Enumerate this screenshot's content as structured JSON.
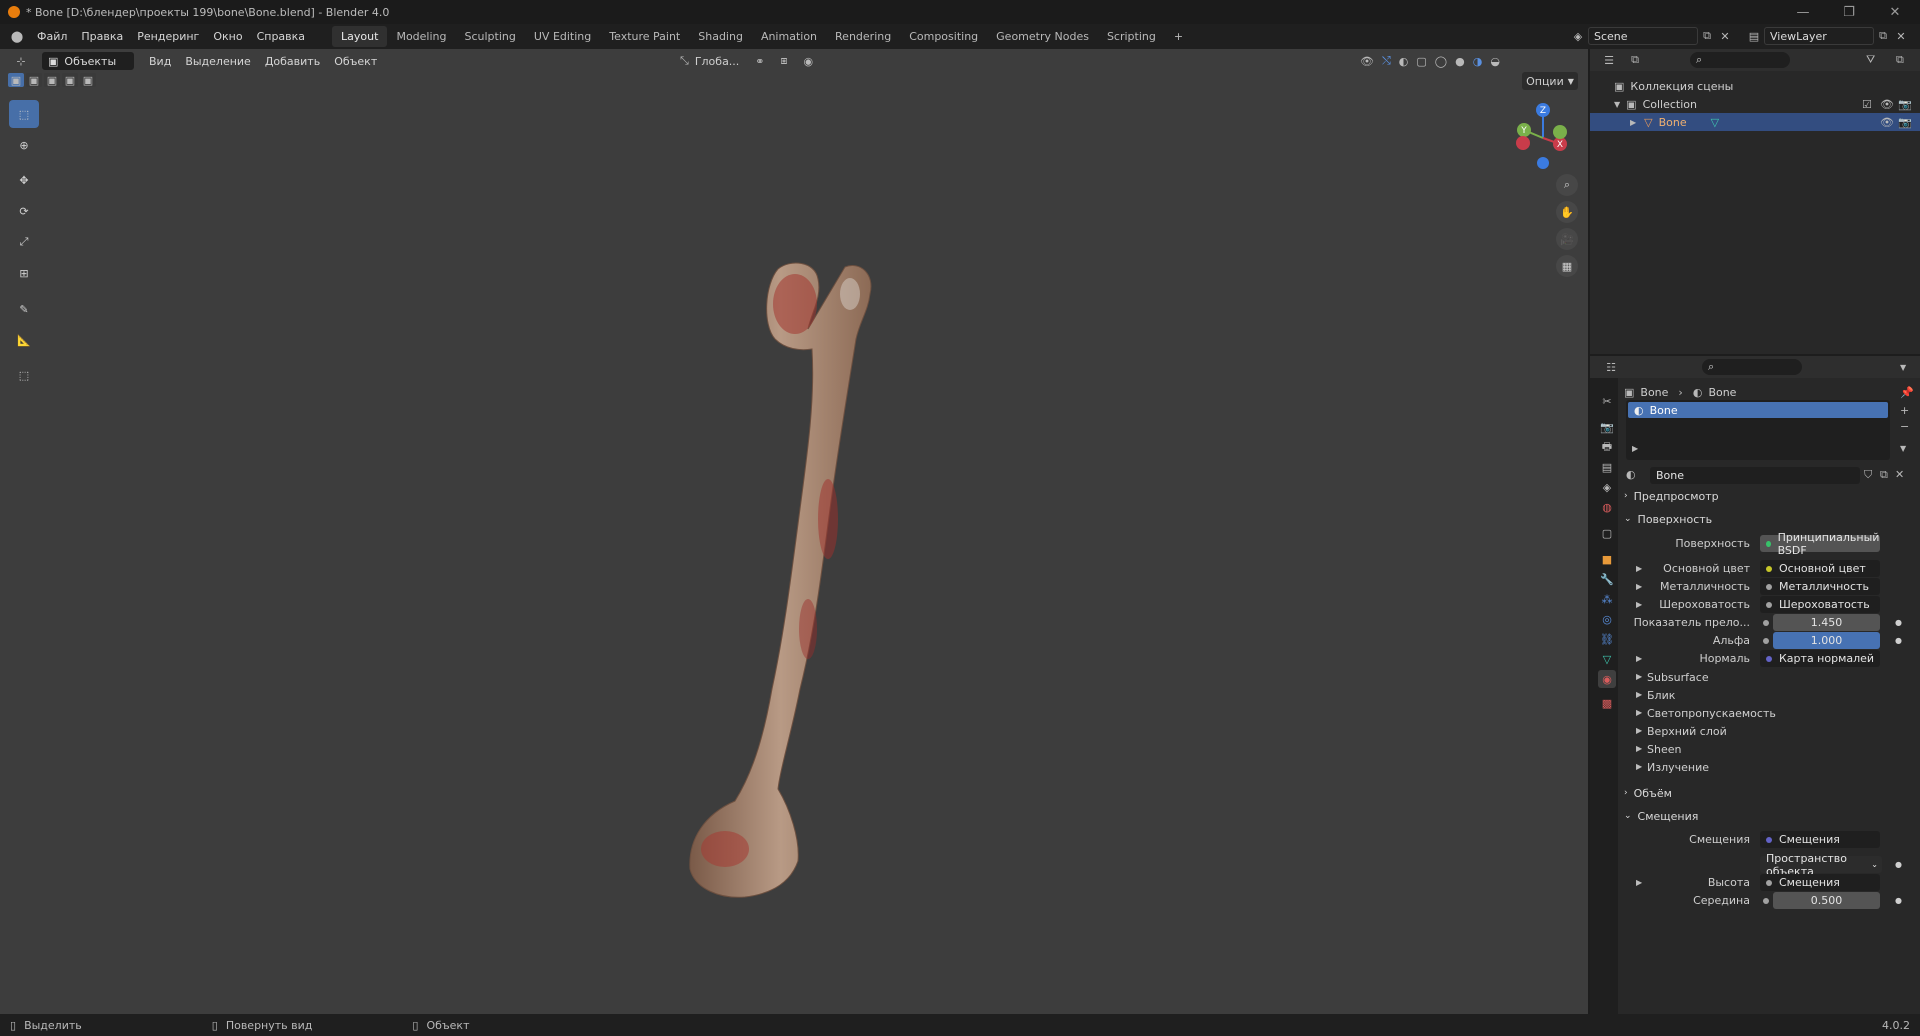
{
  "window": {
    "title": "* Bone [D:\\блендер\\проекты 199\\bone\\Bone.blend] - Blender 4.0"
  },
  "menu": {
    "items": [
      "Файл",
      "Правка",
      "Рендеринг",
      "Окно",
      "Справка"
    ]
  },
  "workspaces": {
    "tabs": [
      "Layout",
      "Modeling",
      "Sculpting",
      "UV Editing",
      "Texture Paint",
      "Shading",
      "Animation",
      "Rendering",
      "Compositing",
      "Geometry Nodes",
      "Scripting"
    ],
    "active": "Layout",
    "add": "+"
  },
  "scene": {
    "name": "Scene",
    "view_layer": "ViewLayer"
  },
  "viewport": {
    "mode": "Объекты",
    "menus": [
      "Вид",
      "Выделение",
      "Добавить",
      "Объект"
    ],
    "orientation": "Глоба...",
    "options_label": "Опции",
    "gizmo": {
      "x": "X",
      "y": "Y",
      "z": "Z"
    }
  },
  "outliner": {
    "root": "Коллекция сцены",
    "collection": "Collection",
    "object": "Bone"
  },
  "properties": {
    "breadcrumb": [
      "Bone",
      "Bone"
    ],
    "slot": "Bone",
    "material_name": "Bone",
    "panels": {
      "preview": "Предпросмотр",
      "surface": "Поверхность",
      "volume": "Объём",
      "displacement": "Смещения"
    },
    "surface_rows": [
      {
        "label": "Поверхность",
        "value": "Принципиальный BSDF",
        "dot": "#38c26a"
      },
      {
        "label": "Основной цвет",
        "value": "Основной цвет",
        "dot": "#c7c729"
      },
      {
        "label": "Металличность",
        "value": "Металличность",
        "dot": "#a1a1a1"
      },
      {
        "label": "Шероховатость",
        "value": "Шероховатость",
        "dot": "#a1a1a1"
      },
      {
        "label": "Показатель прело...",
        "value": "1.450",
        "dot": "#a1a1a1"
      },
      {
        "label": "Альфа",
        "value": "1.000",
        "dot": "#a1a1a1"
      },
      {
        "label": "Нормаль",
        "value": "Карта нормалей",
        "dot": "#6363c7"
      }
    ],
    "subpanels": [
      "Subsurface",
      "Блик",
      "Светопропускаемость",
      "Верхний слой",
      "Sheen",
      "Излучение"
    ],
    "displacement_rows": [
      {
        "label": "Смещения",
        "value": "Смещения",
        "dot": "#6363c7"
      },
      {
        "label": "",
        "value": "Пространство объекта",
        "dot": ""
      },
      {
        "label": "Высота",
        "value": "Смещения",
        "dot": "#a1a1a1"
      },
      {
        "label": "Середина",
        "value": "0.500",
        "dot": "#a1a1a1"
      }
    ]
  },
  "status": {
    "select": "Выделить",
    "rotate": "Повернуть вид",
    "object": "Объект",
    "version": "4.0.2"
  }
}
